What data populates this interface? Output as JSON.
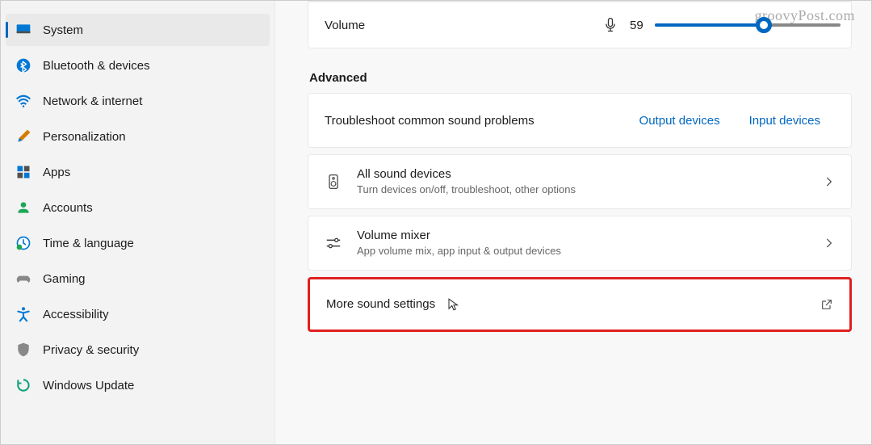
{
  "watermark": "groovyPost.com",
  "sidebar": {
    "selected_index": 0,
    "items": [
      {
        "label": "System"
      },
      {
        "label": "Bluetooth & devices"
      },
      {
        "label": "Network & internet"
      },
      {
        "label": "Personalization"
      },
      {
        "label": "Apps"
      },
      {
        "label": "Accounts"
      },
      {
        "label": "Time & language"
      },
      {
        "label": "Gaming"
      },
      {
        "label": "Accessibility"
      },
      {
        "label": "Privacy & security"
      },
      {
        "label": "Windows Update"
      }
    ]
  },
  "volume": {
    "label": "Volume",
    "value": "59",
    "percent": 59
  },
  "advanced": {
    "heading": "Advanced",
    "troubleshoot": {
      "label": "Troubleshoot common sound problems",
      "output_link": "Output devices",
      "input_link": "Input devices"
    },
    "all_devices": {
      "title": "All sound devices",
      "subtitle": "Turn devices on/off, troubleshoot, other options"
    },
    "volume_mixer": {
      "title": "Volume mixer",
      "subtitle": "App volume mix, app input & output devices"
    },
    "more": {
      "label": "More sound settings"
    }
  }
}
